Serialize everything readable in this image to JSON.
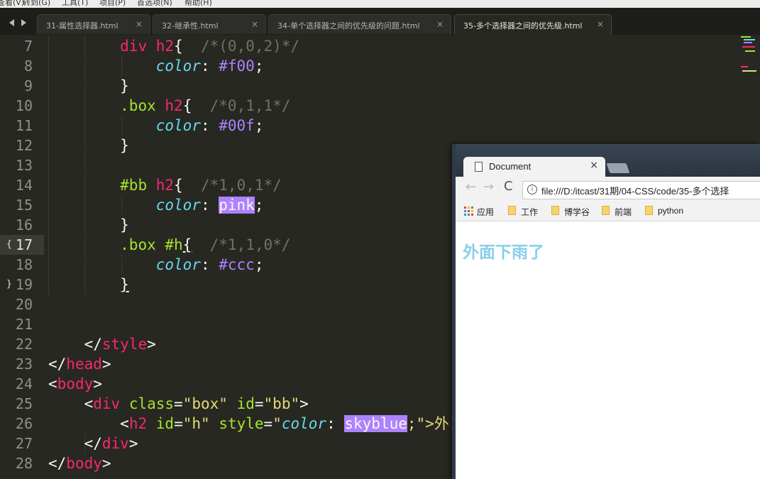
{
  "menubar": {
    "items": [
      "查看(V)",
      "转到(G)",
      "工具(T)",
      "项目(P)",
      "首选项(N)",
      "帮助(H)"
    ]
  },
  "tabs": [
    {
      "label": "31-属性选择器.html",
      "close": "×"
    },
    {
      "label": "32-继承性.html",
      "close": "×"
    },
    {
      "label": "34-单个选择器之间的优先级的问题.html",
      "close": "×"
    },
    {
      "label": "35-多个选择器之间的优先级.html",
      "close": "×",
      "active": true
    }
  ],
  "editor": {
    "line_numbers": [
      "7",
      "8",
      "9",
      "10",
      "11",
      "12",
      "13",
      "14",
      "15",
      "16",
      "17",
      "18",
      "19",
      "20",
      "21",
      "22",
      "23",
      "24",
      "25",
      "26",
      "27",
      "28"
    ],
    "current_line": "17",
    "fold_marks": {
      "open": "{",
      "close": "}"
    },
    "code": {
      "l7": {
        "selector": "div",
        "tag": "h2",
        "brace": "{",
        "comment": "/*(0,0,2)*/"
      },
      "l8": {
        "prop": "color",
        "value": "#f00",
        "semi": ";"
      },
      "l9": {
        "brace": "}"
      },
      "l10": {
        "selector": ".box",
        "tag": "h2",
        "brace": "{",
        "comment": "/*0,1,1*/"
      },
      "l11": {
        "prop": "color",
        "value": "#00f",
        "semi": ";"
      },
      "l12": {
        "brace": "}"
      },
      "l14": {
        "selector": "#bb",
        "tag": "h2",
        "brace": "{",
        "comment": "/*1,0,1*/"
      },
      "l15": {
        "prop": "color",
        "value": "pink",
        "semi": ";"
      },
      "l16": {
        "brace": "}"
      },
      "l17": {
        "selector": ".box #h",
        "brace": "{",
        "comment": "/*1,1,0*/"
      },
      "l18": {
        "prop": "color",
        "value": "#ccc",
        "semi": ";"
      },
      "l19": {
        "brace": "}"
      },
      "l22": {
        "open": "</",
        "tag": "style",
        "close": ">"
      },
      "l23": {
        "open": "</",
        "tag": "head",
        "close": ">"
      },
      "l24": {
        "open": "<",
        "tag": "body",
        "close": ">"
      },
      "l25": {
        "open": "<",
        "tag": "div",
        "attr1": "class",
        "val1": "\"box\"",
        "attr2": "id",
        "val2": "\"bb\"",
        "close": ">"
      },
      "l26": {
        "open": "<",
        "tag": "h2",
        "attr1": "id",
        "val1": "\"h\"",
        "attr2": "style",
        "quote": "\"",
        "prop": "color",
        "colon": ":",
        "value": "skyblue",
        "tail": ";\">外"
      },
      "l27": {
        "open": "</",
        "tag": "div",
        "close": ">"
      },
      "l28": {
        "open": "</",
        "tag": "body",
        "close": ">"
      }
    }
  },
  "browser": {
    "tab_title": "Document",
    "tab_close": "×",
    "back": "←",
    "forward": "→",
    "reload": "C",
    "info": "i",
    "url": "file:///D:/itcast/31期/04-CSS/code/35-多个选择",
    "bookmarks": [
      {
        "label": "应用",
        "icon": "apps-icon"
      },
      {
        "label": "工作",
        "icon": "folder-icon"
      },
      {
        "label": "博学谷",
        "icon": "folder-icon"
      },
      {
        "label": "前端",
        "icon": "folder-icon"
      },
      {
        "label": "python",
        "icon": "folder-icon"
      }
    ],
    "page_heading": "外面下雨了",
    "page_heading_color": "#87ceeb"
  },
  "colors": {
    "editor_bg": "#272822",
    "tag": "#f92672",
    "property": "#66d9ef",
    "number": "#ae81ff",
    "comment": "#75715e",
    "attribute": "#a6e22e",
    "string": "#e6db74"
  }
}
